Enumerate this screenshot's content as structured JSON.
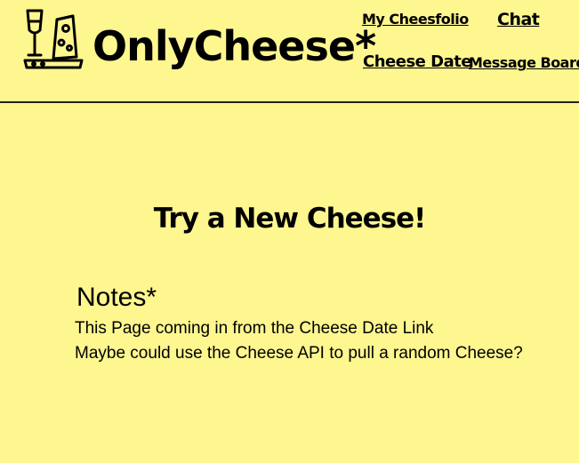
{
  "header": {
    "logo_icon": "wine-glass-and-cheese-board-icon",
    "brand": "OnlyCheese*",
    "nav": {
      "my_cheesfolio": "My Cheesfolio",
      "chat": "Chat",
      "cheese_date": "Cheese Date",
      "message_board": "Message Board"
    }
  },
  "main": {
    "title": "Try a New Cheese!",
    "notes": {
      "heading": "Notes*",
      "lines": [
        "This Page coming in from the Cheese Date Link",
        "Maybe could use the Cheese API to pull a random Cheese?"
      ]
    }
  },
  "colors": {
    "background": "#fef68f",
    "text": "#000000",
    "divider": "#222222"
  }
}
